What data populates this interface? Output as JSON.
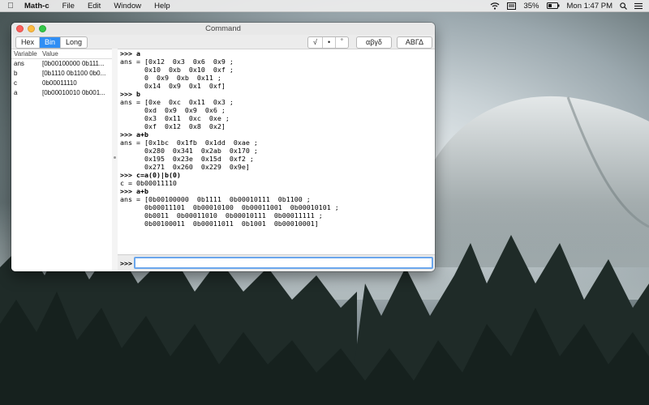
{
  "menubar": {
    "app_name": "Math-c",
    "menus": [
      "File",
      "Edit",
      "Window",
      "Help"
    ],
    "battery": "35%",
    "clock": "Mon 1:47 PM"
  },
  "window": {
    "title": "Command",
    "format_tabs": [
      {
        "label": "Hex",
        "selected": false
      },
      {
        "label": "Bin",
        "selected": true
      },
      {
        "label": "Long",
        "selected": false
      }
    ],
    "operator_buttons": [
      "√",
      "•",
      "˚"
    ],
    "greek_lower_button": "αβγδ",
    "greek_upper_button": "ΑΒΓΔ"
  },
  "variables": {
    "header": {
      "name": "Variable",
      "value": "Value"
    },
    "rows": [
      {
        "name": "ans",
        "value": "[0b00100000 0b111..."
      },
      {
        "name": "b",
        "value": "[0b1110 0b1100 0b0..."
      },
      {
        "name": "c",
        "value": "0b00011110"
      },
      {
        "name": "a",
        "value": "[0b00010010 0b001..."
      }
    ]
  },
  "console": {
    "lines": [
      {
        "text": ">>> a",
        "cmd": true
      },
      {
        "text": "ans = [0x12  0x3  0x6  0x9 ;",
        "cmd": false
      },
      {
        "text": "      0x10  0xb  0x10  0xf ;",
        "cmd": false
      },
      {
        "text": "      0  0x9  0xb  0x11 ;",
        "cmd": false
      },
      {
        "text": "      0x14  0x9  0x1  0xf]",
        "cmd": false
      },
      {
        "text": ">>> b",
        "cmd": true
      },
      {
        "text": "ans = [0xe  0xc  0x11  0x3 ;",
        "cmd": false
      },
      {
        "text": "      0xd  0x9  0x9  0x6 ;",
        "cmd": false
      },
      {
        "text": "      0x3  0x11  0xc  0xe ;",
        "cmd": false
      },
      {
        "text": "      0xf  0x12  0x8  0x2]",
        "cmd": false
      },
      {
        "text": ">>> a+b",
        "cmd": true
      },
      {
        "text": "ans = [0x1bc  0x1fb  0x1dd  0xae ;",
        "cmd": false
      },
      {
        "text": "      0x280  0x341  0x2ab  0x170 ;",
        "cmd": false
      },
      {
        "text": "      0x195  0x23e  0x15d  0xf2 ;",
        "cmd": false
      },
      {
        "text": "      0x271  0x260  0x229  0x9e]",
        "cmd": false
      },
      {
        "text": ">>> c=a(0)|b(0)",
        "cmd": true
      },
      {
        "text": "c = 0b00011110",
        "cmd": false
      },
      {
        "text": ">>> a+b",
        "cmd": true
      },
      {
        "text": "ans = [0b00100000  0b1111  0b00010111  0b1100 ;",
        "cmd": false
      },
      {
        "text": "      0b00011101  0b00010100  0b00011001  0b00010101 ;",
        "cmd": false
      },
      {
        "text": "      0b0011  0b00011010  0b00010111  0b00011111 ;",
        "cmd": false
      },
      {
        "text": "      0b00100011  0b00011011  0b1001  0b00010001]",
        "cmd": false
      }
    ],
    "prompt": ">>>",
    "input_value": ""
  }
}
